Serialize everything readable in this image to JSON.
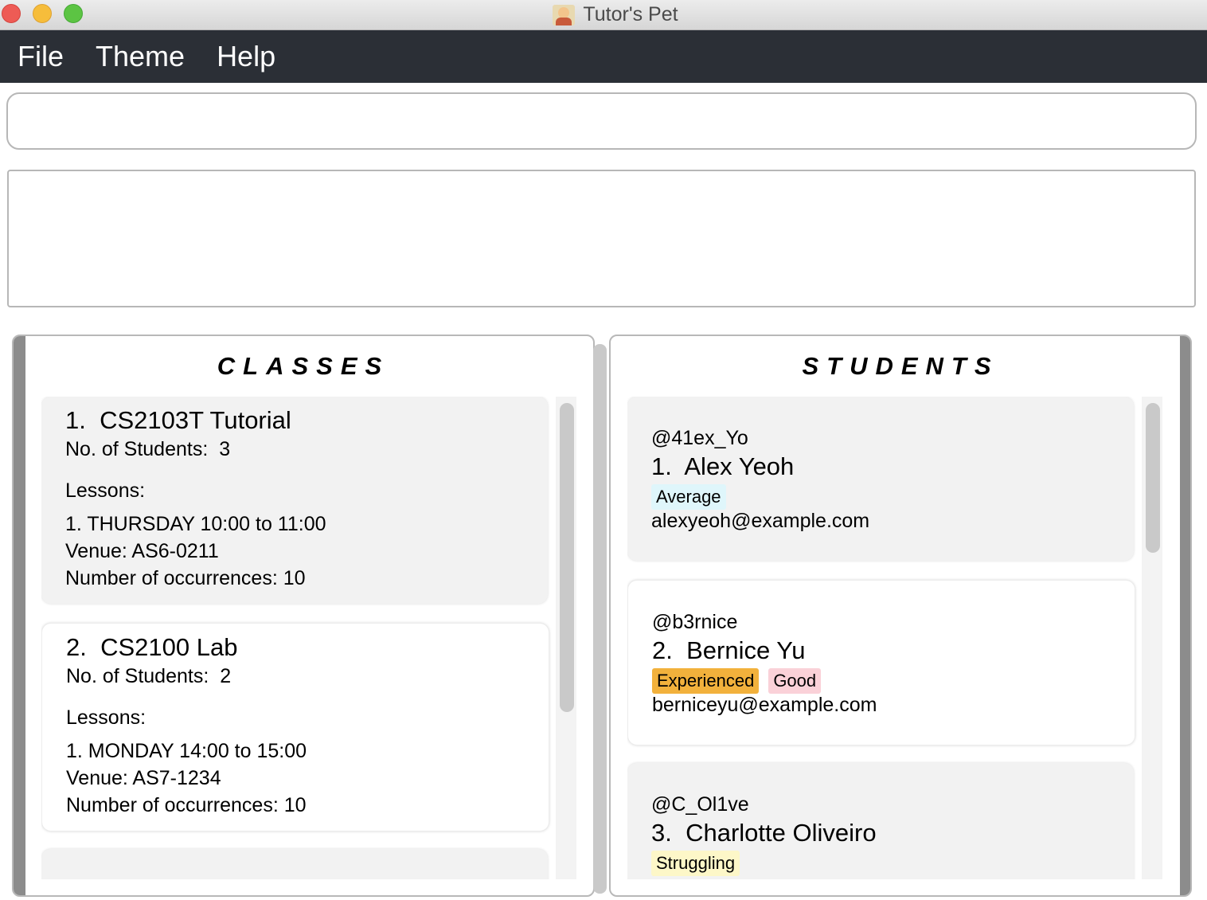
{
  "window": {
    "title": "Tutor's Pet"
  },
  "menu": {
    "items": [
      "File",
      "Theme",
      "Help"
    ]
  },
  "command": {
    "value": ""
  },
  "result": {
    "text": ""
  },
  "classes": {
    "header": "CLASSES",
    "items": [
      {
        "index": "1.",
        "name": "CS2103T Tutorial",
        "students_label": "No. of Students:",
        "students": "3",
        "lessons_label": "Lessons:",
        "lesson": "1. THURSDAY 10:00 to 11:00",
        "venue": "Venue: AS6-0211",
        "occurrences": "Number of occurrences: 10"
      },
      {
        "index": "2.",
        "name": "CS2100 Lab",
        "students_label": "No. of Students:",
        "students": "2",
        "lessons_label": "Lessons:",
        "lesson": "1. MONDAY 14:00 to 15:00",
        "venue": "Venue: AS7-1234",
        "occurrences": "Number of occurrences: 10"
      }
    ]
  },
  "students": {
    "header": "STUDENTS",
    "items": [
      {
        "handle": "@41ex_Yo",
        "index": "1.",
        "name": "Alex Yeoh",
        "tags": [
          {
            "label": "Average",
            "color": "#dff6fb"
          }
        ],
        "email": "alexyeoh@example.com"
      },
      {
        "handle": "@b3rnice",
        "index": "2.",
        "name": "Bernice Yu",
        "tags": [
          {
            "label": "Experienced",
            "color": "#f2b13c"
          },
          {
            "label": "Good",
            "color": "#fad1d8"
          }
        ],
        "email": "berniceyu@example.com"
      },
      {
        "handle": "@C_Ol1ve",
        "index": "3.",
        "name": "Charlotte Oliveiro",
        "tags": [
          {
            "label": "Struggling",
            "color": "#fdf7c8"
          }
        ],
        "email": ""
      }
    ]
  }
}
